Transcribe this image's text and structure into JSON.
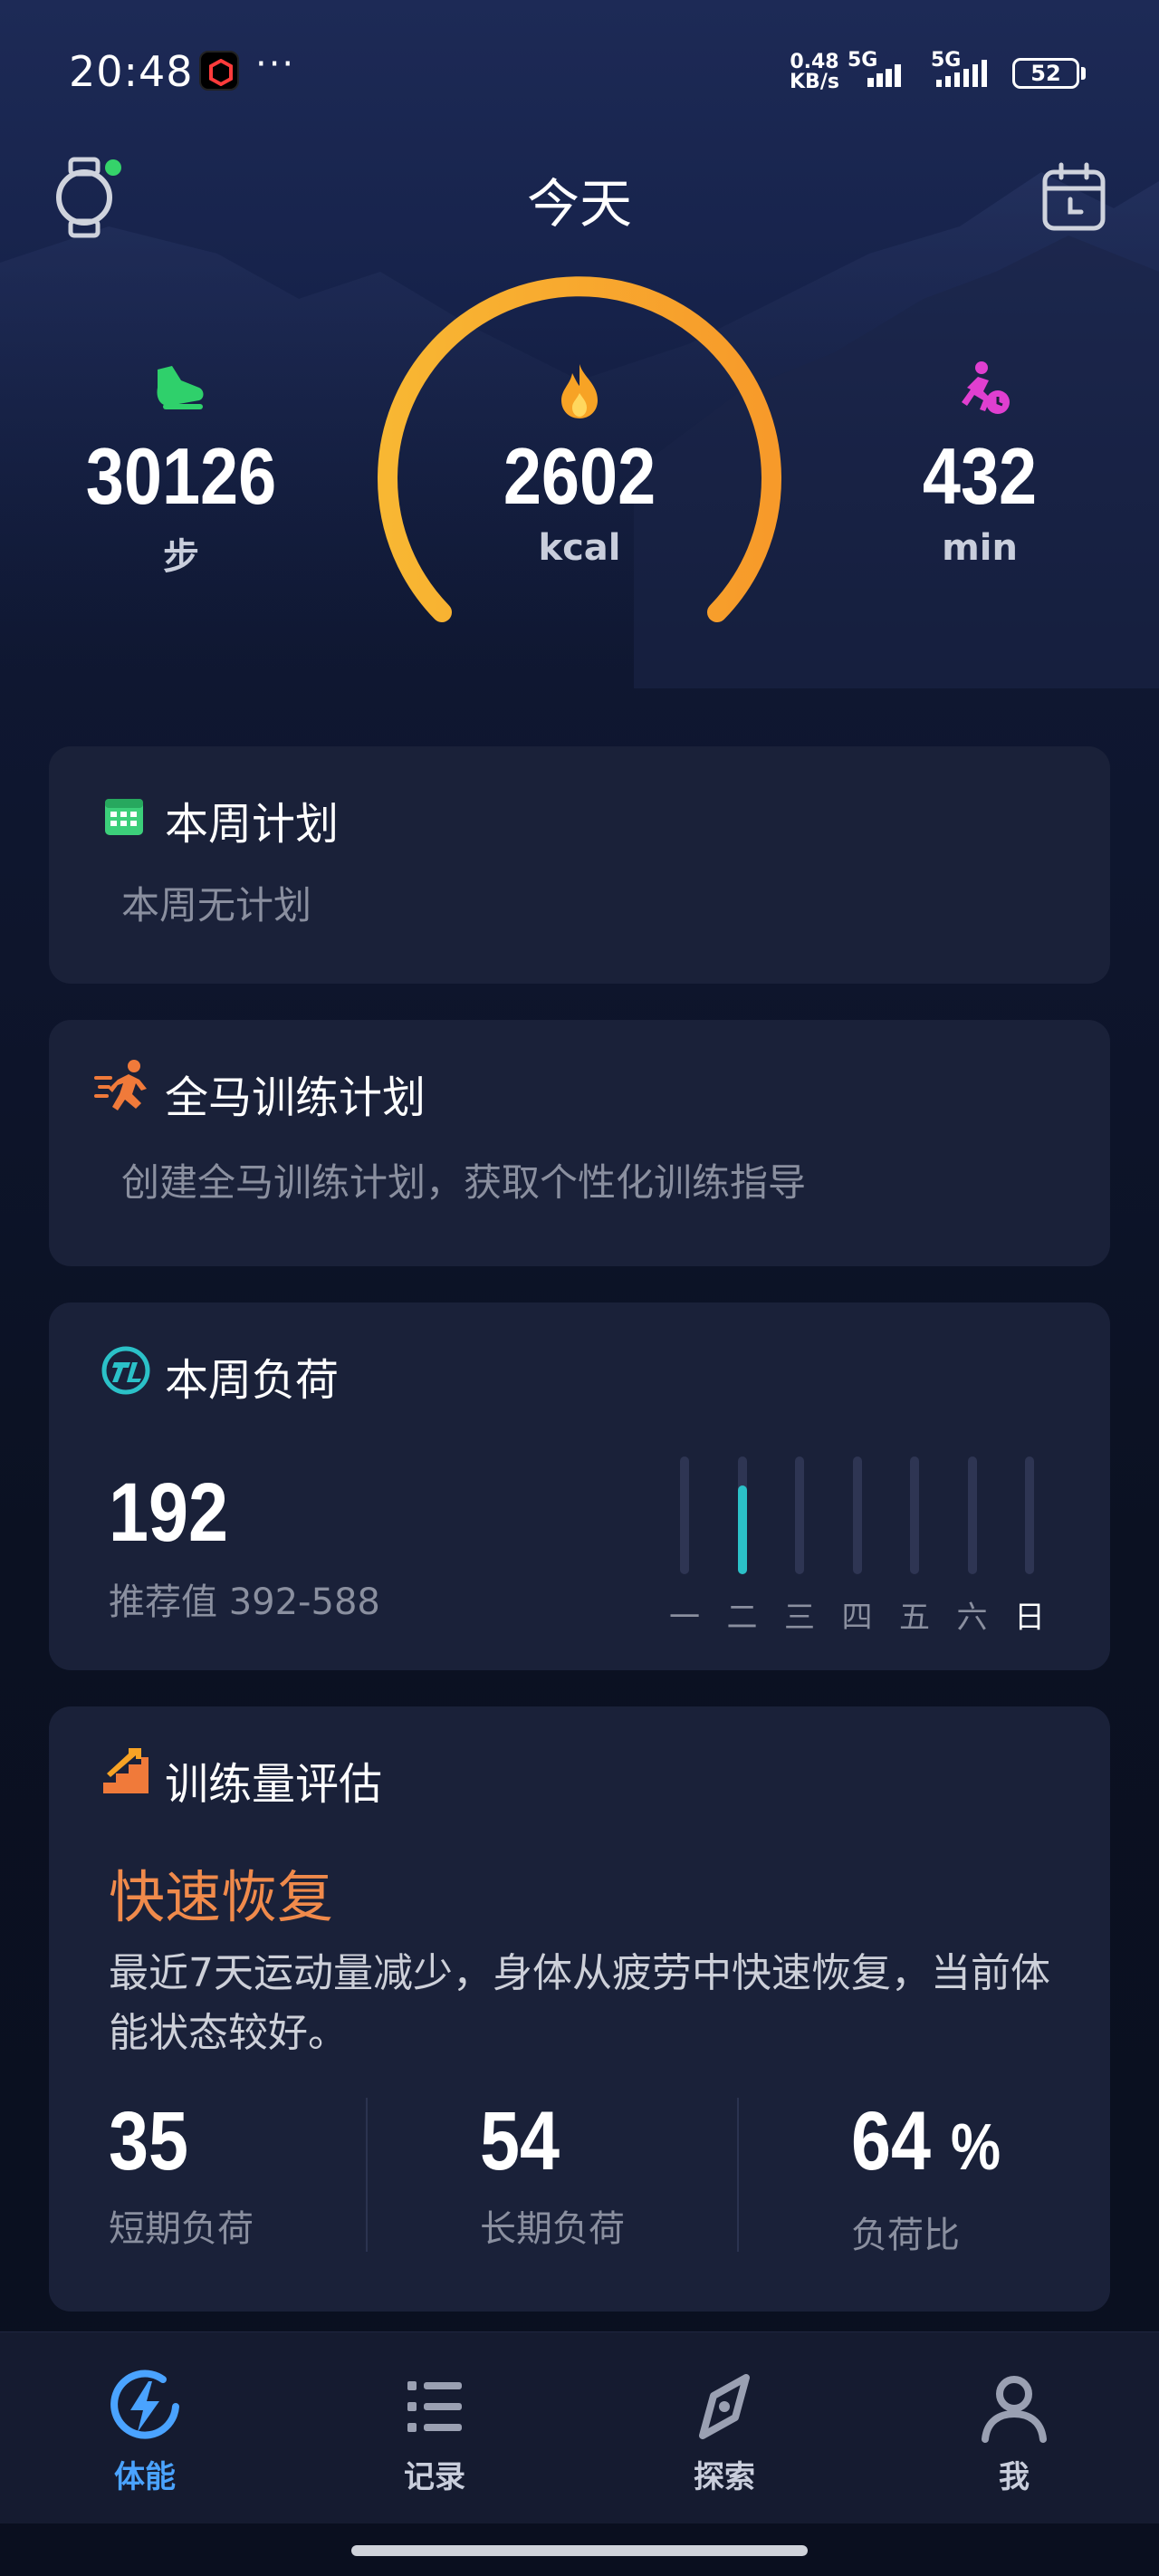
{
  "status_bar": {
    "time": "20:48",
    "net_speed_top": "0.48",
    "net_speed_bottom": "KB/s",
    "signal1_label": "5G",
    "signal2_label": "5G",
    "battery": "52"
  },
  "header": {
    "title": "今天"
  },
  "stats": {
    "steps": {
      "value": "30126",
      "unit": "步"
    },
    "calories": {
      "value": "2602",
      "unit": "kcal"
    },
    "active_time": {
      "value": "432",
      "unit": "min"
    }
  },
  "cards": {
    "weekly_plan": {
      "title": "本周计划",
      "subtitle": "本周无计划"
    },
    "marathon_plan": {
      "title": "全马训练计划",
      "subtitle": "创建全马训练计划，获取个性化训练指导"
    },
    "weekly_load": {
      "title": "本周负荷",
      "value": "192",
      "recommended": "推荐值 392-588",
      "days": [
        "一",
        "二",
        "三",
        "四",
        "五",
        "六",
        "日"
      ],
      "day_levels": [
        0,
        0.75,
        0,
        0,
        0,
        0,
        0
      ],
      "active_day_index": 6
    },
    "training_assessment": {
      "title": "训练量评估",
      "state": "快速恢复",
      "description": "最近7天运动量减少，身体从疲劳中快速恢复，当前体能状态较好。",
      "metrics": [
        {
          "value": "35",
          "label": "短期负荷"
        },
        {
          "value": "54",
          "label": "长期负荷"
        },
        {
          "value": "64",
          "suffix": "%",
          "label": "负荷比"
        }
      ]
    }
  },
  "tabs": [
    {
      "label": "体能",
      "icon": "bolt-icon",
      "active": true
    },
    {
      "label": "记录",
      "icon": "list-icon",
      "active": false
    },
    {
      "label": "探索",
      "icon": "compass-icon",
      "active": false
    },
    {
      "label": "我",
      "icon": "person-icon",
      "active": false
    }
  ],
  "colors": {
    "accent_blue": "#4aa3ff",
    "gauge_orange": "#f7a325",
    "state_orange": "#f08a4b",
    "load_teal": "#2bc1c8"
  }
}
